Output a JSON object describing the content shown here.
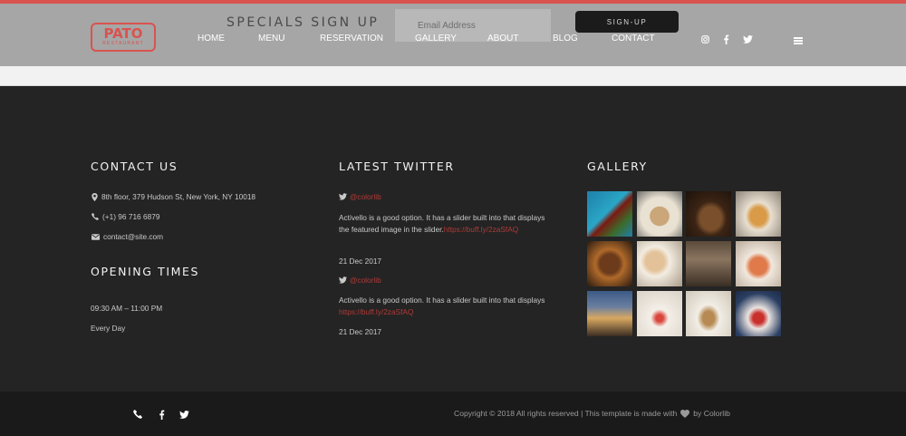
{
  "header": {
    "logo_title": "PATO",
    "logo_subtitle": "RESTAURANT",
    "specials_title": "SPECIALS SIGN UP",
    "email_placeholder": "Email Address",
    "signup_label": "SIGN-UP",
    "nav": [
      "HOME",
      "MENU",
      "RESERVATION",
      "GALLERY",
      "ABOUT",
      "BLOG",
      "CONTACT"
    ],
    "social_icons": [
      "instagram-icon",
      "facebook-icon",
      "twitter-icon"
    ],
    "menu_icon": "hamburger-menu-icon"
  },
  "contact": {
    "title": "CONTACT US",
    "address": "8th floor, 379 Hudson St, New York, NY 10018",
    "phone": "(+1) 96 716 6879",
    "email": "contact@site.com"
  },
  "opening": {
    "title": "OPENING TIMES",
    "hours": "09:30 AM – 11:00 PM",
    "days": "Every Day"
  },
  "twitter": {
    "title": "LATEST TWITTER",
    "tweets": [
      {
        "handle": "@colorlib",
        "text": "Activello is a good option. It has a slider built into that displays the featured image in the slider.",
        "link": "https://buff.ly/2zaSfAQ",
        "date": "21 Dec 2017"
      },
      {
        "handle": "@colorlib",
        "text": "Activello is a good option. It has a slider built into that displays ",
        "link": "https://buff.ly/2zaSfAQ",
        "date": "21 Dec 2017"
      }
    ]
  },
  "gallery": {
    "title": "GALLERY",
    "photos": [
      "salad-on-blue-table-photo",
      "dining-table-photo",
      "grilled-steak-photo",
      "fish-dish-photo",
      "steak-plate-photo",
      "breakfast-spread-photo",
      "restaurant-interior-photo",
      "shrimp-dish-photo",
      "city-evening-photo",
      "dessert-plate-photo",
      "plated-dish-photo",
      "hands-holding-dish-photo"
    ]
  },
  "footer": {
    "social_icons": [
      "phone-icon",
      "facebook-icon",
      "twitter-icon"
    ],
    "copyright_before": "Copyright © 2018 All rights reserved | This template is made with",
    "copyright_after": "by Colorlib"
  },
  "colors": {
    "accent": "#d9534f",
    "link": "#b03a36",
    "footer_bg": "#242424",
    "bottom_bar_bg": "#1a1a1a",
    "header_bg": "#a6a6a6"
  }
}
